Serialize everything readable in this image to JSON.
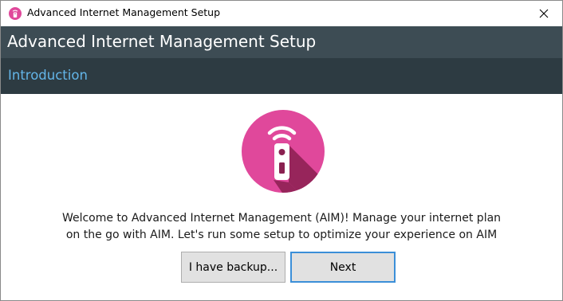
{
  "window": {
    "title": "Advanced Internet Management Setup",
    "close_glyph": "✕"
  },
  "header": {
    "title": "Advanced Internet Management Setup"
  },
  "step": {
    "title": "Introduction"
  },
  "welcome": {
    "line1": "Welcome to Advanced Internet Management (AIM)! Manage your internet plan",
    "line2": "on the go with AIM. Let's run some setup to optimize your experience on AIM"
  },
  "buttons": {
    "backup_label": "I have backup...",
    "next_label": "Next"
  },
  "icons": {
    "app": "remote-wifi-icon",
    "hero": "remote-wifi-icon",
    "close": "close-icon"
  },
  "colors": {
    "header_bg": "#3d4c54",
    "subheader_bg": "#2d3b42",
    "step_text": "#63b5e8",
    "brand_pink": "#e0489b",
    "brand_dark": "#8a2050",
    "focus_border": "#3b8fd8"
  }
}
